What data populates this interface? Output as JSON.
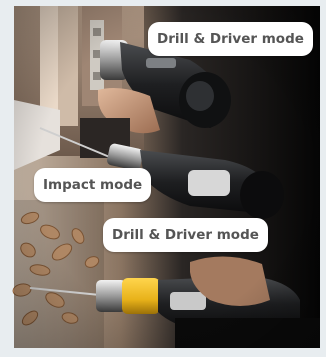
{
  "labels": [
    {
      "text": "Drill & Driver mode"
    },
    {
      "text": "Impact mode"
    },
    {
      "text": "Drill & Driver mode"
    }
  ],
  "colors": {
    "label_background": "#ffffff",
    "label_text": "#555555",
    "accent_yellow": "#e8b21a",
    "drill_dark": "#1d1e20"
  }
}
